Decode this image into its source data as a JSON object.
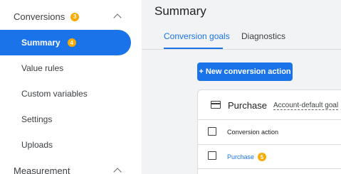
{
  "sidebar": {
    "conversions": {
      "label": "Conversions",
      "badge": "3"
    },
    "items": [
      {
        "label": "Summary",
        "badge": "4",
        "active": true
      },
      {
        "label": "Value rules"
      },
      {
        "label": "Custom variables"
      },
      {
        "label": "Settings"
      },
      {
        "label": "Uploads"
      }
    ],
    "measurement": {
      "label": "Measurement"
    }
  },
  "main": {
    "title": "Summary",
    "tabs": [
      {
        "label": "Conversion goals",
        "active": true
      },
      {
        "label": "Diagnostics"
      }
    ],
    "new_action_label": "+ New conversion action",
    "card": {
      "title": "Purchase",
      "goal_tag": "Account-default goal",
      "column_header": "Conversion action",
      "row": {
        "label": "Purchase",
        "badge": "5"
      }
    }
  },
  "colors": {
    "accent": "#1a73e8",
    "badge": "#f9ab00",
    "background": "#f1f3f4"
  },
  "icons": [
    "chevron-up-icon",
    "credit-card-icon",
    "checkbox-icon"
  ]
}
